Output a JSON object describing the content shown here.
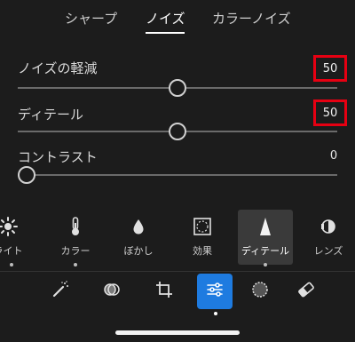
{
  "tabs": [
    {
      "label": "シャープ",
      "active": false
    },
    {
      "label": "ノイズ",
      "active": true
    },
    {
      "label": "カラーノイズ",
      "active": false
    }
  ],
  "sliders": [
    {
      "label": "ノイズの軽減",
      "value": "50",
      "level": 0.5,
      "highlighted": true
    },
    {
      "label": "ディテール",
      "value": "50",
      "level": 0.5,
      "highlighted": true
    },
    {
      "label": "コントラスト",
      "value": "0",
      "level": 0.0,
      "highlighted": false
    }
  ],
  "tools": [
    {
      "label": "ライト",
      "icon": "sun-icon"
    },
    {
      "label": "カラー",
      "icon": "thermometer-icon"
    },
    {
      "label": "ぼかし",
      "icon": "droplet-icon"
    },
    {
      "label": "効果",
      "icon": "vignette-icon"
    },
    {
      "label": "ディテール",
      "icon": "triangle-icon",
      "selected": true
    },
    {
      "label": "レンズ",
      "icon": "lens-icon"
    }
  ],
  "bottombar": [
    {
      "icon": "magic-wand-icon"
    },
    {
      "icon": "mix-circles-icon"
    },
    {
      "icon": "crop-rotate-icon"
    },
    {
      "icon": "sliders-icon",
      "active": true
    },
    {
      "icon": "selective-circle-icon"
    },
    {
      "icon": "eraser-icon"
    }
  ],
  "colors": {
    "background": "#1c1c1c",
    "accent": "#1e7be0",
    "highlight_box": "#e60012"
  }
}
